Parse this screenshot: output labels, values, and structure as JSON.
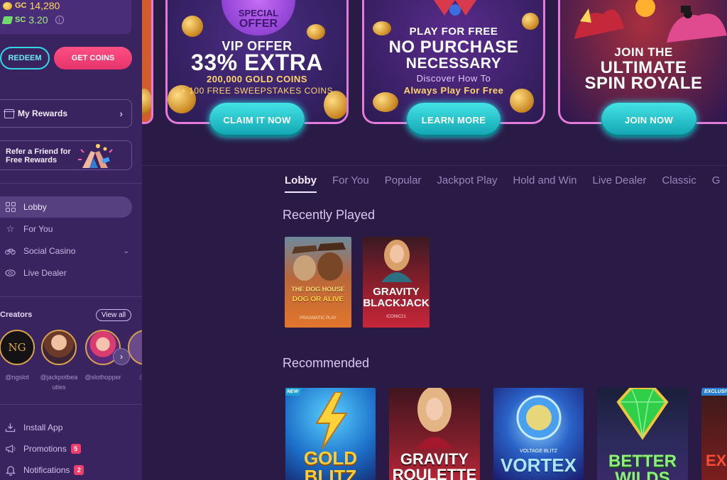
{
  "balances": {
    "gc_label": "GC",
    "gc_value": "14,280",
    "sc_label": "SC",
    "sc_value": "3.20",
    "info_icon": "i"
  },
  "buttons": {
    "redeem": "REDEEM",
    "get_coins": "GET COINS"
  },
  "cards": {
    "rewards_label": "My Rewards",
    "refer_label": "Refer a Friend for Free Rewards"
  },
  "nav": {
    "items": [
      {
        "label": "Lobby",
        "icon": "grid-icon"
      },
      {
        "label": "For You",
        "icon": "star-icon"
      },
      {
        "label": "Social Casino",
        "icon": "bicycle-icon"
      },
      {
        "label": "Live Dealer",
        "icon": "casino-chip-icon"
      }
    ]
  },
  "creators": {
    "title": "Creators",
    "view_all": "View all",
    "list": [
      {
        "name": "@ngslot",
        "color": "#1c1a1c"
      },
      {
        "name": "@jackpotbeauties",
        "color": "#b56a4a"
      },
      {
        "name": "@slothopper",
        "color": "#8d4db3"
      },
      {
        "name": "@ca",
        "color": "#6a4a8a"
      }
    ]
  },
  "bottom_nav": {
    "install": "Install App",
    "promotions": "Promotions",
    "promotions_count": "5",
    "notifications": "Notifications",
    "notifications_count": "2"
  },
  "banners": {
    "vip": {
      "badge_line1": "SPECIAL",
      "badge_line2": "OFFER",
      "line1": "VIP OFFER",
      "line2": "33% EXTRA",
      "line3": "200,000 GOLD COINS",
      "line4": "+ 100 FREE SWEEPSTAKES COINS",
      "cta": "CLAIM IT NOW"
    },
    "free": {
      "line1": "PLAY FOR FREE",
      "line2": "NO PURCHASE",
      "line3": "NECESSARY",
      "line4": "Discover How To",
      "line5": "Always Play For Free",
      "cta": "LEARN MORE"
    },
    "join": {
      "line1": "JOIN THE",
      "line2": "ULTIMATE",
      "line3": "SPIN ROYALE",
      "cta": "JOIN NOW"
    }
  },
  "tabs": [
    "Lobby",
    "For You",
    "Popular",
    "Jackpot Play",
    "Hold and Win",
    "Live Dealer",
    "Classic",
    "G"
  ],
  "sections": {
    "recently_played": "Recently Played",
    "recommended": "Recommended"
  },
  "recent_games": [
    {
      "title_top": "THE DOG HOUSE",
      "title_bottom": "DOG OR ALIVE",
      "provider": "PRAGMATIC PLAY"
    },
    {
      "title_top": "GRAVITY",
      "title_bottom": "BLACKJACK",
      "provider": "ICONIC21"
    }
  ],
  "recommended_games": [
    {
      "title": "GOLD BLITZ",
      "tag": "NEW"
    },
    {
      "title": "GRAVITY ROULETTE",
      "tag": ""
    },
    {
      "title": "VORTEX",
      "tag": "",
      "sub": "VOLTAGE BLITZ"
    },
    {
      "title": "BETTER WILDS",
      "tag": ""
    },
    {
      "title": "EX",
      "tag": "EXCLUSIVE"
    }
  ],
  "colors": {
    "accent_cyan": "#35d6e6",
    "accent_pink": "#ef3d6c",
    "sidebar_bg": "#3a2460",
    "main_bg": "#2a1a46"
  }
}
